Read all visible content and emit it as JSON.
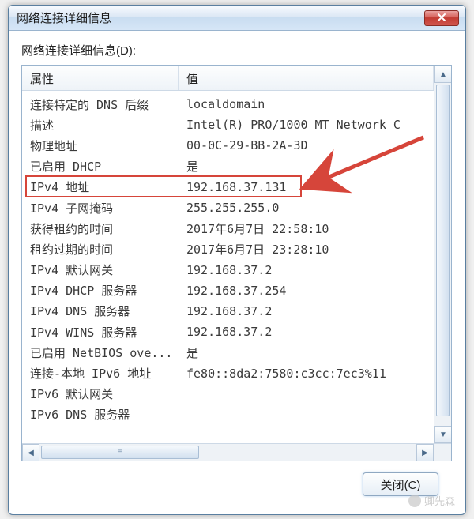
{
  "window": {
    "title": "网络连接详细信息"
  },
  "subtitle": "网络连接详细信息(D):",
  "columns": {
    "property": "属性",
    "value": "值"
  },
  "rows": [
    {
      "prop": "连接特定的 DNS 后缀",
      "val": "localdomain"
    },
    {
      "prop": "描述",
      "val": "Intel(R) PRO/1000 MT Network C"
    },
    {
      "prop": "物理地址",
      "val": "00-0C-29-BB-2A-3D"
    },
    {
      "prop": "已启用 DHCP",
      "val": "是"
    },
    {
      "prop": "IPv4 地址",
      "val": "192.168.37.131"
    },
    {
      "prop": "IPv4 子网掩码",
      "val": "255.255.255.0"
    },
    {
      "prop": "获得租约的时间",
      "val": "2017年6月7日 22:58:10"
    },
    {
      "prop": "租约过期的时间",
      "val": "2017年6月7日 23:28:10"
    },
    {
      "prop": "IPv4 默认网关",
      "val": "192.168.37.2"
    },
    {
      "prop": "IPv4 DHCP 服务器",
      "val": "192.168.37.254"
    },
    {
      "prop": "IPv4 DNS 服务器",
      "val": "192.168.37.2"
    },
    {
      "prop": "IPv4 WINS 服务器",
      "val": "192.168.37.2"
    },
    {
      "prop": "已启用 NetBIOS ove...",
      "val": "是"
    },
    {
      "prop": "连接-本地 IPv6 地址",
      "val": "fe80::8da2:7580:c3cc:7ec3%11"
    },
    {
      "prop": "IPv6 默认网关",
      "val": ""
    },
    {
      "prop": "IPv6 DNS 服务器",
      "val": ""
    }
  ],
  "highlight_row_index": 4,
  "footer": {
    "close_label": "关闭(C)"
  },
  "watermark": "卿先森"
}
